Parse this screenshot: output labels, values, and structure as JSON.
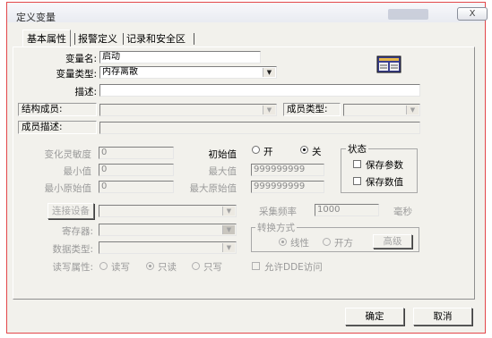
{
  "window": {
    "title": "定义变量",
    "close_label": "X"
  },
  "tabs": [
    "基本属性",
    "报警定义",
    "记录和安全区"
  ],
  "basic": {
    "var_name_label": "变量名:",
    "var_name_value": "启动",
    "var_type_label": "变量类型:",
    "var_type_value": "内存离散",
    "desc_label": "描述:",
    "desc_value": "",
    "struct_member_label": "结构成员:",
    "member_type_label": "成员类型:",
    "member_desc_label": "成员描述:"
  },
  "numeric": {
    "sensitivity_label": "变化灵敏度",
    "sensitivity_value": "0",
    "min_label": "最小值",
    "min_value": "0",
    "min_raw_label": "最小原始值",
    "min_raw_value": "0",
    "initial_label": "初始值",
    "initial_on_label": "开",
    "initial_off_label": "关",
    "initial_selected": "关",
    "max_label": "最大值",
    "max_value": "999999999",
    "max_raw_label": "最大原始值",
    "max_raw_value": "999999999"
  },
  "status": {
    "title": "状态",
    "save_params_label": "保存参数",
    "save_values_label": "保存数值"
  },
  "io": {
    "connect_device_label": "连接设备",
    "register_label": "寄存器:",
    "data_type_label": "数据类型:",
    "rw_label": "读写属性:",
    "rw_options": [
      "读写",
      "只读",
      "只写"
    ],
    "rw_selected": "只读",
    "sample_rate_label": "采集频率",
    "sample_rate_value": "1000",
    "sample_rate_unit": "毫秒",
    "convert_title": "转换方式",
    "convert_options": [
      "线性",
      "开方"
    ],
    "convert_selected": "线性",
    "advanced_label": "高级",
    "allow_dde_label": "允许DDE访问"
  },
  "footer": {
    "ok_label": "确定",
    "cancel_label": "取消"
  }
}
